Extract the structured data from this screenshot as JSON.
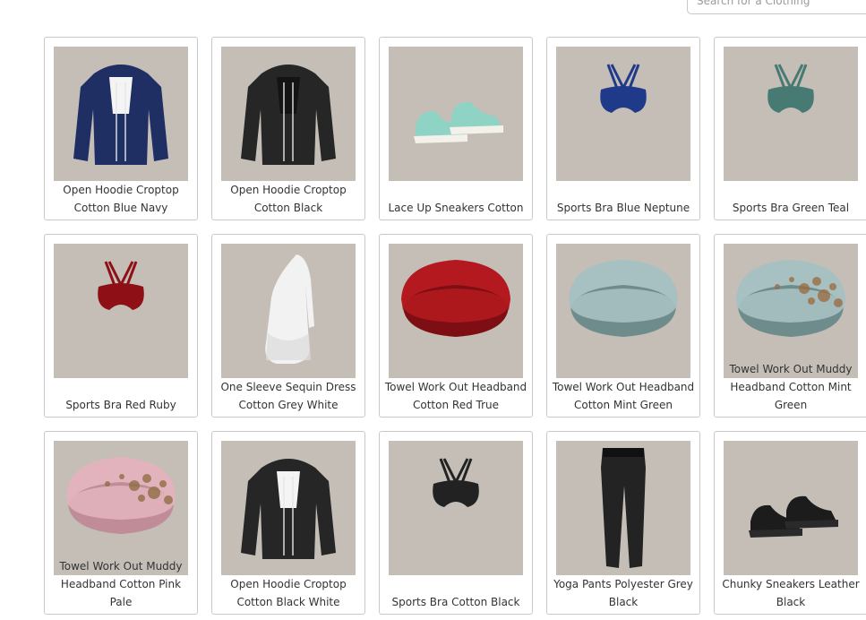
{
  "search": {
    "placeholder": "Search for a Clothing"
  },
  "items": [
    {
      "label": "Open Hoodie Croptop Cotton Blue Navy",
      "icon": "hoodie-icon",
      "color": "#1f2f63",
      "inner": "#f4f4f4"
    },
    {
      "label": "Open Hoodie Croptop Cotton Black",
      "icon": "hoodie-icon",
      "color": "#262626",
      "inner": "#141414"
    },
    {
      "label": "Lace Up Sneakers Cotton",
      "icon": "sneakers-icon",
      "color": "#8fd3c4",
      "sole": "#f3f1ea"
    },
    {
      "label": "Sports Bra Blue Neptune",
      "icon": "sports-bra-icon",
      "color": "#203a8a"
    },
    {
      "label": "Sports Bra Green Teal",
      "icon": "sports-bra-icon",
      "color": "#467a73"
    },
    {
      "label": "Sports Bra Red Ruby",
      "icon": "sports-bra-icon",
      "color": "#8e0f16"
    },
    {
      "label": "One Sleeve Sequin Dress Cotton Grey White",
      "icon": "dress-icon",
      "color": "#f2f2f2"
    },
    {
      "label": "Towel Work Out Headband Cotton Red True",
      "icon": "headband-icon",
      "color": "#b3191e",
      "band": "#7d0e14"
    },
    {
      "label": "Towel Work Out Headband Cotton Mint Green",
      "icon": "headband-icon",
      "color": "#a7c0c1",
      "band": "#6f8c8d"
    },
    {
      "label": "Towel Work Out Muddy Headband Cotton Mint Green",
      "icon": "headband-muddy-icon",
      "color": "#a7c0c1",
      "band": "#6f8c8d",
      "mud": "#9a6a3c"
    },
    {
      "label": "Towel Work Out Muddy Headband Cotton Pink Pale",
      "icon": "headband-muddy-icon",
      "color": "#e2b3bd",
      "band": "#c08c98",
      "mud": "#8a6a3e"
    },
    {
      "label": "Open Hoodie Croptop Cotton Black White",
      "icon": "hoodie-icon",
      "color": "#262626",
      "inner": "#f4f4f4"
    },
    {
      "label": "Sports Bra Cotton Black",
      "icon": "sports-bra-icon",
      "color": "#222222"
    },
    {
      "label": "Yoga Pants Polyester Grey Black",
      "icon": "leggings-icon",
      "color": "#232323"
    },
    {
      "label": "Chunky Sneakers Leather Black",
      "icon": "sneakers-icon",
      "color": "#1c1c1c",
      "sole": "#2a2a2a"
    }
  ]
}
